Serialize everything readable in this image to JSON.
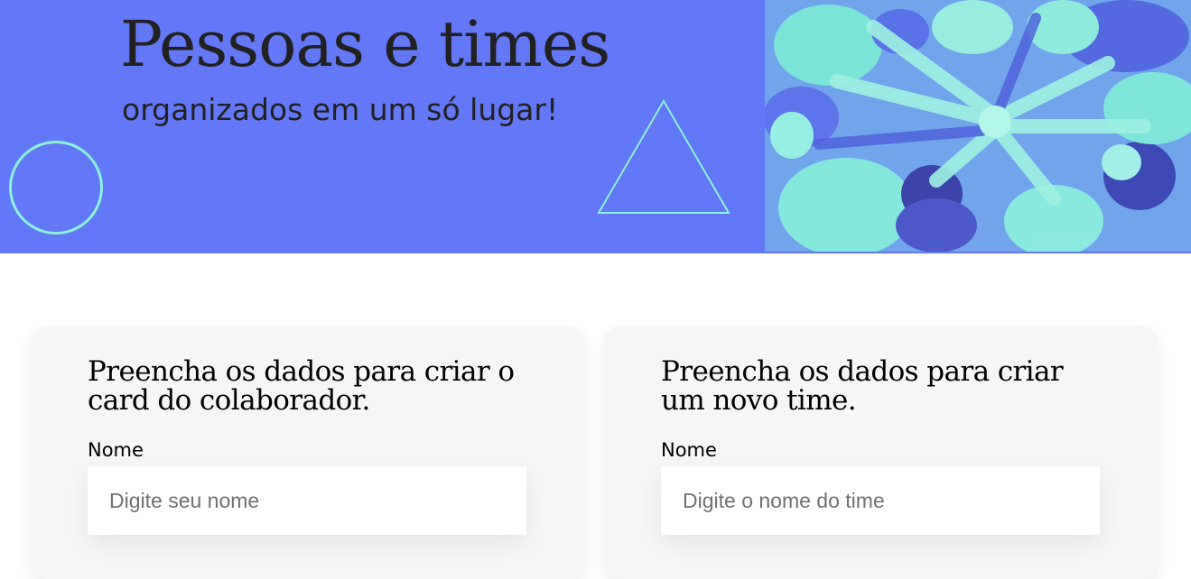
{
  "banner": {
    "title": "Pessoas e times",
    "subtitle": "organizados em um só lugar!",
    "background_color": "#6278f7",
    "accent_color": "#8ef0d8"
  },
  "forms": {
    "collaborator": {
      "heading": "Preencha os dados para criar o card do colaborador.",
      "name_label": "Nome",
      "name_placeholder": "Digite seu nome",
      "name_value": ""
    },
    "team": {
      "heading": "Preencha os dados para criar um novo time.",
      "name_label": "Nome",
      "name_placeholder": "Digite o nome do time",
      "name_value": ""
    }
  }
}
